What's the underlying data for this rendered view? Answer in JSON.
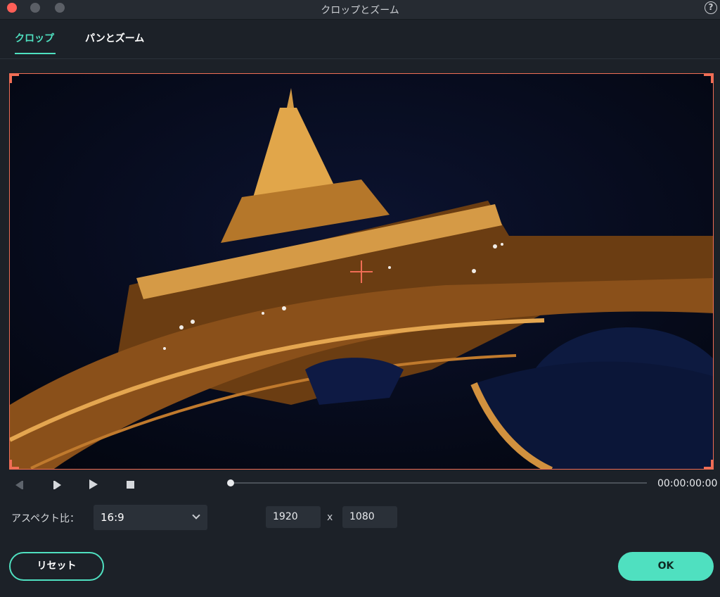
{
  "window": {
    "title": "クロップとズーム",
    "help_label": "?",
    "colors": {
      "close": "#ff5f57",
      "inactive": "#5b5f66"
    }
  },
  "tabs": [
    {
      "label": "クロップ",
      "active": true
    },
    {
      "label": "パンとズーム",
      "active": false
    }
  ],
  "preview": {
    "image_subject": "eiffel-tower-night",
    "crop_border_color": "#ef6d55"
  },
  "transport": {
    "timecode": "00:00:00:00",
    "icons": [
      "prev-frame-icon",
      "next-frame-icon",
      "play-icon",
      "stop-icon"
    ]
  },
  "aspect": {
    "label": "アスペクト比：",
    "selected": "16:9",
    "width": "1920",
    "height": "1080",
    "times": "x"
  },
  "buttons": {
    "reset": "リセット",
    "ok": "OK"
  },
  "accent_color": "#4fe0c0"
}
